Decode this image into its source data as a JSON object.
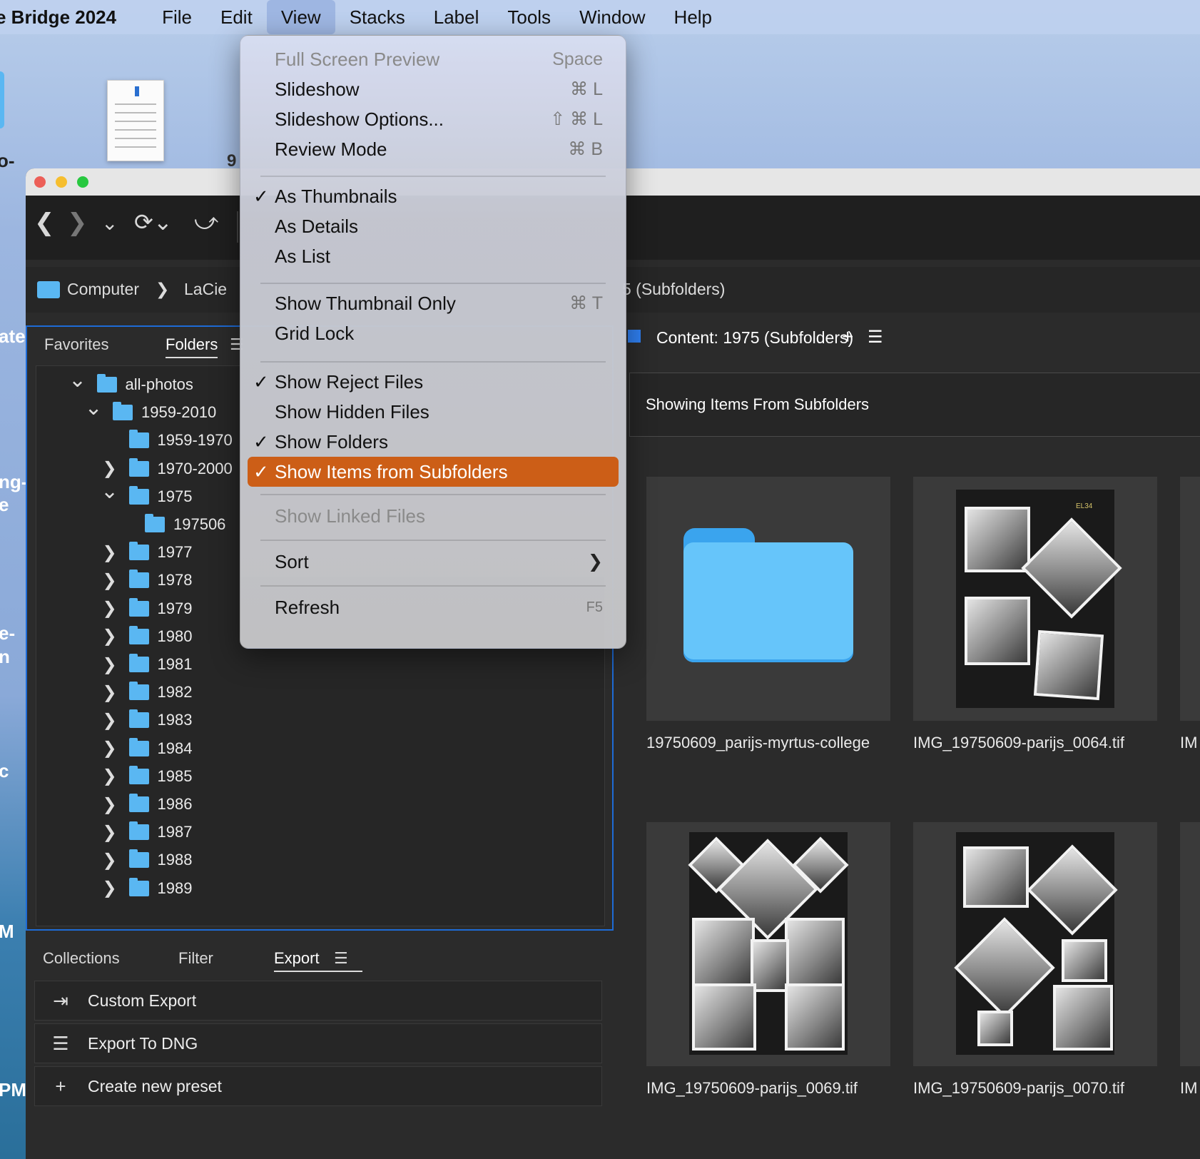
{
  "menubar": {
    "app": "e Bridge 2024",
    "items": [
      "File",
      "Edit",
      "View",
      "Stacks",
      "Label",
      "Tools",
      "Window",
      "Help"
    ]
  },
  "desktop": {
    "labels": [
      "o-",
      "9",
      "ates",
      "ng-",
      "e",
      "e-",
      "n",
      "c",
      "M",
      "PM"
    ]
  },
  "window": {
    "breadcrumb": {
      "computer": "Computer",
      "volume": "LaCie",
      "current": "5 (Subfolders)"
    }
  },
  "folders_panel": {
    "tabs": {
      "favorites": "Favorites",
      "folders": "Folders"
    },
    "tree": [
      {
        "label": "all-photos",
        "chev": "open"
      },
      {
        "label": "1959-2010",
        "chev": "open"
      },
      {
        "label": "1959-1970",
        "chev": "none"
      },
      {
        "label": "1970-2000",
        "chev": "closed"
      },
      {
        "label": "1975",
        "chev": "open"
      },
      {
        "label": "197506",
        "chev": "none"
      },
      {
        "label": "1977",
        "chev": "closed"
      },
      {
        "label": "1978",
        "chev": "closed"
      },
      {
        "label": "1979",
        "chev": "closed"
      },
      {
        "label": "1980",
        "chev": "closed"
      },
      {
        "label": "1981",
        "chev": "closed"
      },
      {
        "label": "1982",
        "chev": "closed"
      },
      {
        "label": "1983",
        "chev": "closed"
      },
      {
        "label": "1984",
        "chev": "closed"
      },
      {
        "label": "1985",
        "chev": "closed"
      },
      {
        "label": "1986",
        "chev": "closed"
      },
      {
        "label": "1987",
        "chev": "closed"
      },
      {
        "label": "1988",
        "chev": "closed"
      },
      {
        "label": "1989",
        "chev": "closed"
      }
    ]
  },
  "bottom_panel": {
    "tabs": {
      "collections": "Collections",
      "filter": "Filter",
      "export": "Export"
    },
    "items": [
      "Custom Export",
      "Export To DNG",
      "Create new preset"
    ]
  },
  "content": {
    "tab_label": "Content: 1975 (Subfolders)",
    "add_symbol": "+",
    "banner": "Showing Items From Subfolders",
    "thumbnails": [
      "19750609_parijs-myrtus-college",
      "IMG_19750609-parijs_0064.tif",
      "IMG_19750609-parijs_0069.tif",
      "IMG_19750609-parijs_0070.tif"
    ],
    "partial_labels": [
      "IM",
      "IM"
    ],
    "photo_caption": "EL34"
  },
  "view_menu": {
    "items": {
      "full_screen_preview": {
        "label": "Full Screen Preview",
        "shortcut": "Space"
      },
      "slideshow": {
        "label": "Slideshow",
        "shortcut": "⌘ L"
      },
      "slideshow_options": {
        "label": "Slideshow Options...",
        "shortcut": "⇧ ⌘ L"
      },
      "review_mode": {
        "label": "Review Mode",
        "shortcut": "⌘ B"
      },
      "as_thumbnails": {
        "label": "As Thumbnails"
      },
      "as_details": {
        "label": "As Details"
      },
      "as_list": {
        "label": "As List"
      },
      "show_thumbnail_only": {
        "label": "Show Thumbnail Only",
        "shortcut": "⌘ T"
      },
      "grid_lock": {
        "label": "Grid Lock"
      },
      "show_reject_files": {
        "label": "Show Reject Files"
      },
      "show_hidden_files": {
        "label": "Show Hidden Files"
      },
      "show_folders": {
        "label": "Show Folders"
      },
      "show_items_from_subfolders": {
        "label": "Show Items from Subfolders"
      },
      "show_linked_files": {
        "label": "Show Linked Files"
      },
      "sort": {
        "label": "Sort"
      },
      "refresh": {
        "label": "Refresh",
        "shortcut": "F5"
      }
    },
    "checkmark": "✓",
    "highlight_color": "#cc5e17"
  },
  "colors": {
    "accent_blue": "#1e6bd6",
    "folder_blue": "#5ab7f2",
    "traffic_red": "#ec5f58",
    "traffic_yellow": "#f6be2f",
    "traffic_green": "#28c840"
  }
}
